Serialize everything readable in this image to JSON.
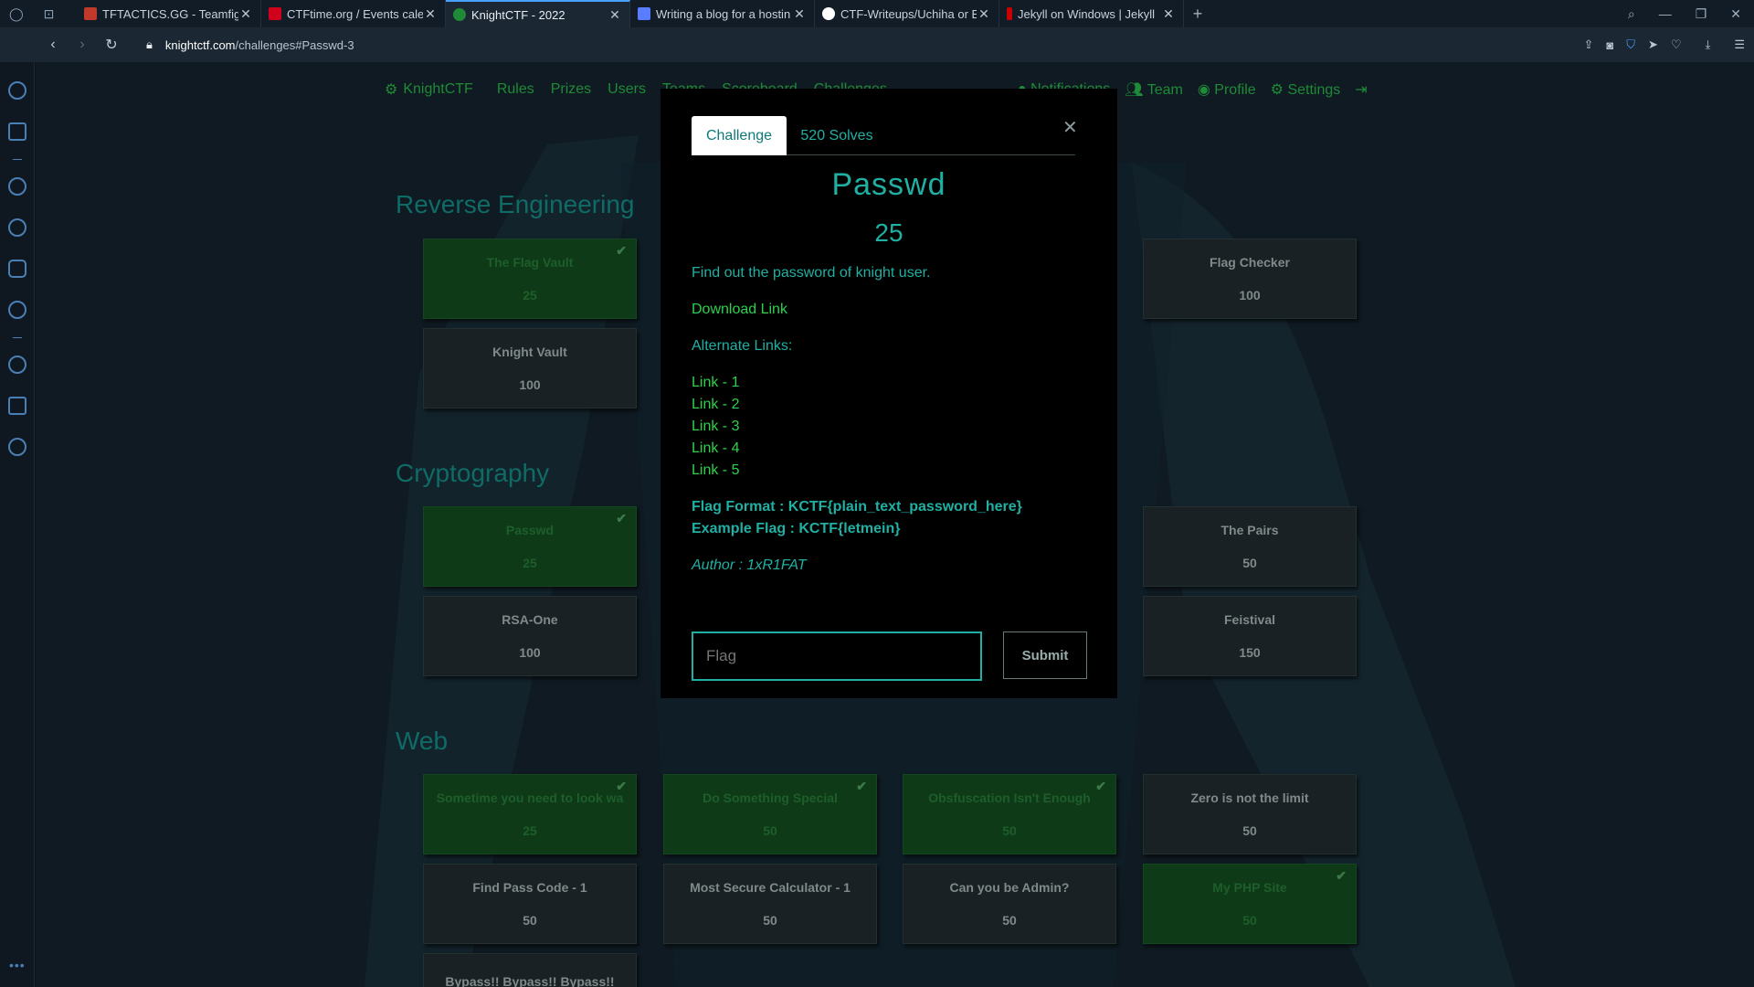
{
  "browser": {
    "tabs": [
      {
        "title": "TFTACTICS.GG - Teamfight",
        "favicon_color": "#c0392b"
      },
      {
        "title": "CTFtime.org / Events calen",
        "favicon_color": "#d0021b"
      },
      {
        "title": "KnightCTF - 2022",
        "favicon_color": "#1f8a37",
        "active": true
      },
      {
        "title": "Writing a blog for a hostin",
        "favicon_color": "#5a7cff"
      },
      {
        "title": "CTF-Writeups/Uchiha or Ev",
        "favicon_color": "#ffffff"
      },
      {
        "title": "Jekyll on Windows | Jekyll",
        "favicon_color": "#cc0000"
      }
    ],
    "url_host": "knightctf.com",
    "url_path": "/challenges#Passwd-3"
  },
  "site_nav": {
    "brand": "KnightCTF",
    "items": [
      "Rules",
      "Prizes",
      "Users",
      "Teams",
      "Scoreboard",
      "Challenges"
    ],
    "right_items": [
      "Notifications",
      "Team",
      "Profile",
      "Settings"
    ]
  },
  "categories": [
    {
      "title": "Reverse Engineering",
      "cards": [
        {
          "name": "The Flag Vault",
          "points": "25",
          "solved": true
        },
        {
          "name": "Flag Checker",
          "points": "100",
          "solved": false
        },
        {
          "name": "Knight Vault",
          "points": "100",
          "solved": false
        }
      ]
    },
    {
      "title": "Cryptography",
      "cards": [
        {
          "name": "Passwd",
          "points": "25",
          "solved": true
        },
        {
          "name": "The Pairs",
          "points": "50",
          "solved": false
        },
        {
          "name": "RSA-One",
          "points": "100",
          "solved": false
        },
        {
          "name": "Feistival",
          "points": "150",
          "solved": false
        }
      ]
    },
    {
      "title": "Web",
      "cards": [
        {
          "name": "Sometime you need to look wa",
          "points": "25",
          "solved": true
        },
        {
          "name": "Do Something Special",
          "points": "50",
          "solved": true
        },
        {
          "name": "Obsfuscation Isn't Enough",
          "points": "50",
          "solved": true
        },
        {
          "name": "Zero is not the limit",
          "points": "50",
          "solved": false
        },
        {
          "name": "Find Pass Code - 1",
          "points": "50",
          "solved": false
        },
        {
          "name": "Most Secure Calculator - 1",
          "points": "50",
          "solved": false
        },
        {
          "name": "Can you be Admin?",
          "points": "50",
          "solved": false
        },
        {
          "name": "My PHP Site",
          "points": "50",
          "solved": true
        },
        {
          "name": "Bypass!! Bypass!! Bypass!!",
          "points": "",
          "solved": false
        }
      ]
    }
  ],
  "modal": {
    "tab_challenge": "Challenge",
    "tab_solves": "520 Solves",
    "name": "Passwd",
    "points": "25",
    "description": "Find out the password of knight user.",
    "download": "Download Link",
    "alternate": "Alternate Links:",
    "links": [
      "Link - 1",
      "Link - 2",
      "Link - 3",
      "Link - 4",
      "Link - 5"
    ],
    "flag_format": "Flag Format : KCTF{plain_text_password_here}",
    "example_flag": "Example Flag : KCTF{letmein}",
    "author": "Author : 1xR1FAT",
    "flag_placeholder": "Flag",
    "submit_label": "Submit"
  }
}
